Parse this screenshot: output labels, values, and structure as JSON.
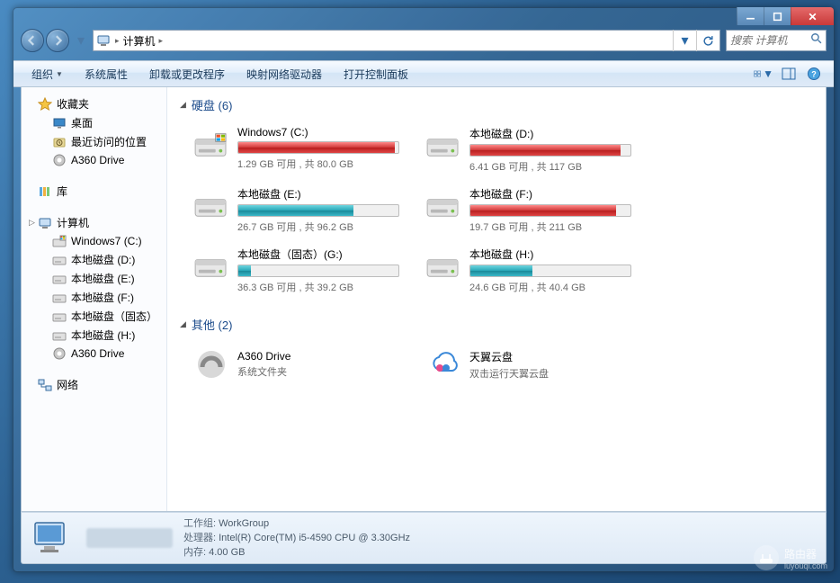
{
  "window_controls": {
    "min": "–",
    "max": "□",
    "close": "✕"
  },
  "breadcrumb": {
    "root_icon": "computer",
    "segments": [
      "计算机"
    ],
    "arrow": "▸"
  },
  "search": {
    "placeholder": "搜索 计算机"
  },
  "toolbar": {
    "organize": "组织",
    "items": [
      "系统属性",
      "卸载或更改程序",
      "映射网络驱动器",
      "打开控制面板"
    ]
  },
  "sidebar": {
    "favorites": {
      "label": "收藏夹",
      "items": [
        "桌面",
        "最近访问的位置",
        "A360 Drive"
      ]
    },
    "libraries": {
      "label": "库"
    },
    "computer": {
      "label": "计算机",
      "items": [
        "Windows7 (C:)",
        "本地磁盘 (D:)",
        "本地磁盘 (E:)",
        "本地磁盘 (F:)",
        "本地磁盘（固态）",
        "本地磁盘 (H:)",
        "A360 Drive"
      ]
    },
    "network": {
      "label": "网络"
    }
  },
  "sections": {
    "drives": {
      "label": "硬盘 (6)"
    },
    "other": {
      "label": "其他 (2)"
    }
  },
  "drives": [
    {
      "name": "Windows7 (C:)",
      "free_text": "1.29 GB 可用 , 共 80.0 GB",
      "fill_pct": 98,
      "color": "red",
      "badge": "win"
    },
    {
      "name": "本地磁盘 (D:)",
      "free_text": "6.41 GB 可用 , 共 117 GB",
      "fill_pct": 94,
      "color": "red"
    },
    {
      "name": "本地磁盘 (E:)",
      "free_text": "26.7 GB 可用 , 共 96.2 GB",
      "fill_pct": 72,
      "color": "teal"
    },
    {
      "name": "本地磁盘 (F:)",
      "free_text": "19.7 GB 可用 , 共 211 GB",
      "fill_pct": 91,
      "color": "red"
    },
    {
      "name": "本地磁盘（固态）(G:)",
      "free_text": "36.3 GB 可用 , 共 39.2 GB",
      "fill_pct": 8,
      "color": "teal"
    },
    {
      "name": "本地磁盘 (H:)",
      "free_text": "24.6 GB 可用 , 共 40.4 GB",
      "fill_pct": 39,
      "color": "teal"
    }
  ],
  "other": [
    {
      "name": "A360 Drive",
      "sub": "系统文件夹",
      "icon": "a360"
    },
    {
      "name": "天翼云盘",
      "sub": "双击运行天翼云盘",
      "icon": "tycloud"
    }
  ],
  "details": {
    "workgroup_label": "工作组:",
    "workgroup": "WorkGroup",
    "cpu_label": "处理器:",
    "cpu": "Intel(R) Core(TM) i5-4590 CPU @ 3.30GHz",
    "mem_label": "内存:",
    "mem": "4.00 GB"
  },
  "watermark": {
    "text": "路由器",
    "sub": "luyouqi.com"
  }
}
